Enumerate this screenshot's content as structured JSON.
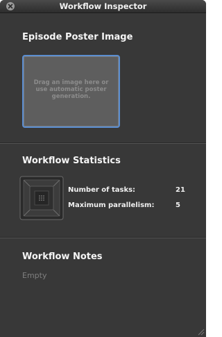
{
  "window": {
    "title": "Workflow Inspector"
  },
  "poster": {
    "heading": "Episode Poster Image",
    "drop_hint": "Drag an image here or use automatic poster generation."
  },
  "statistics": {
    "heading": "Workflow Statistics",
    "icon": "workflow-chip-icon",
    "rows": [
      {
        "label": "Number of tasks:",
        "value": "21"
      },
      {
        "label": "Maximum parallelism:",
        "value": "5"
      }
    ]
  },
  "notes": {
    "heading": "Workflow Notes",
    "text": "Empty"
  },
  "colors": {
    "panel_background": "#383838",
    "drop_well_border": "#5b8ed1",
    "heading_text": "#f5f5f5",
    "muted_text": "#7f7f7f"
  }
}
